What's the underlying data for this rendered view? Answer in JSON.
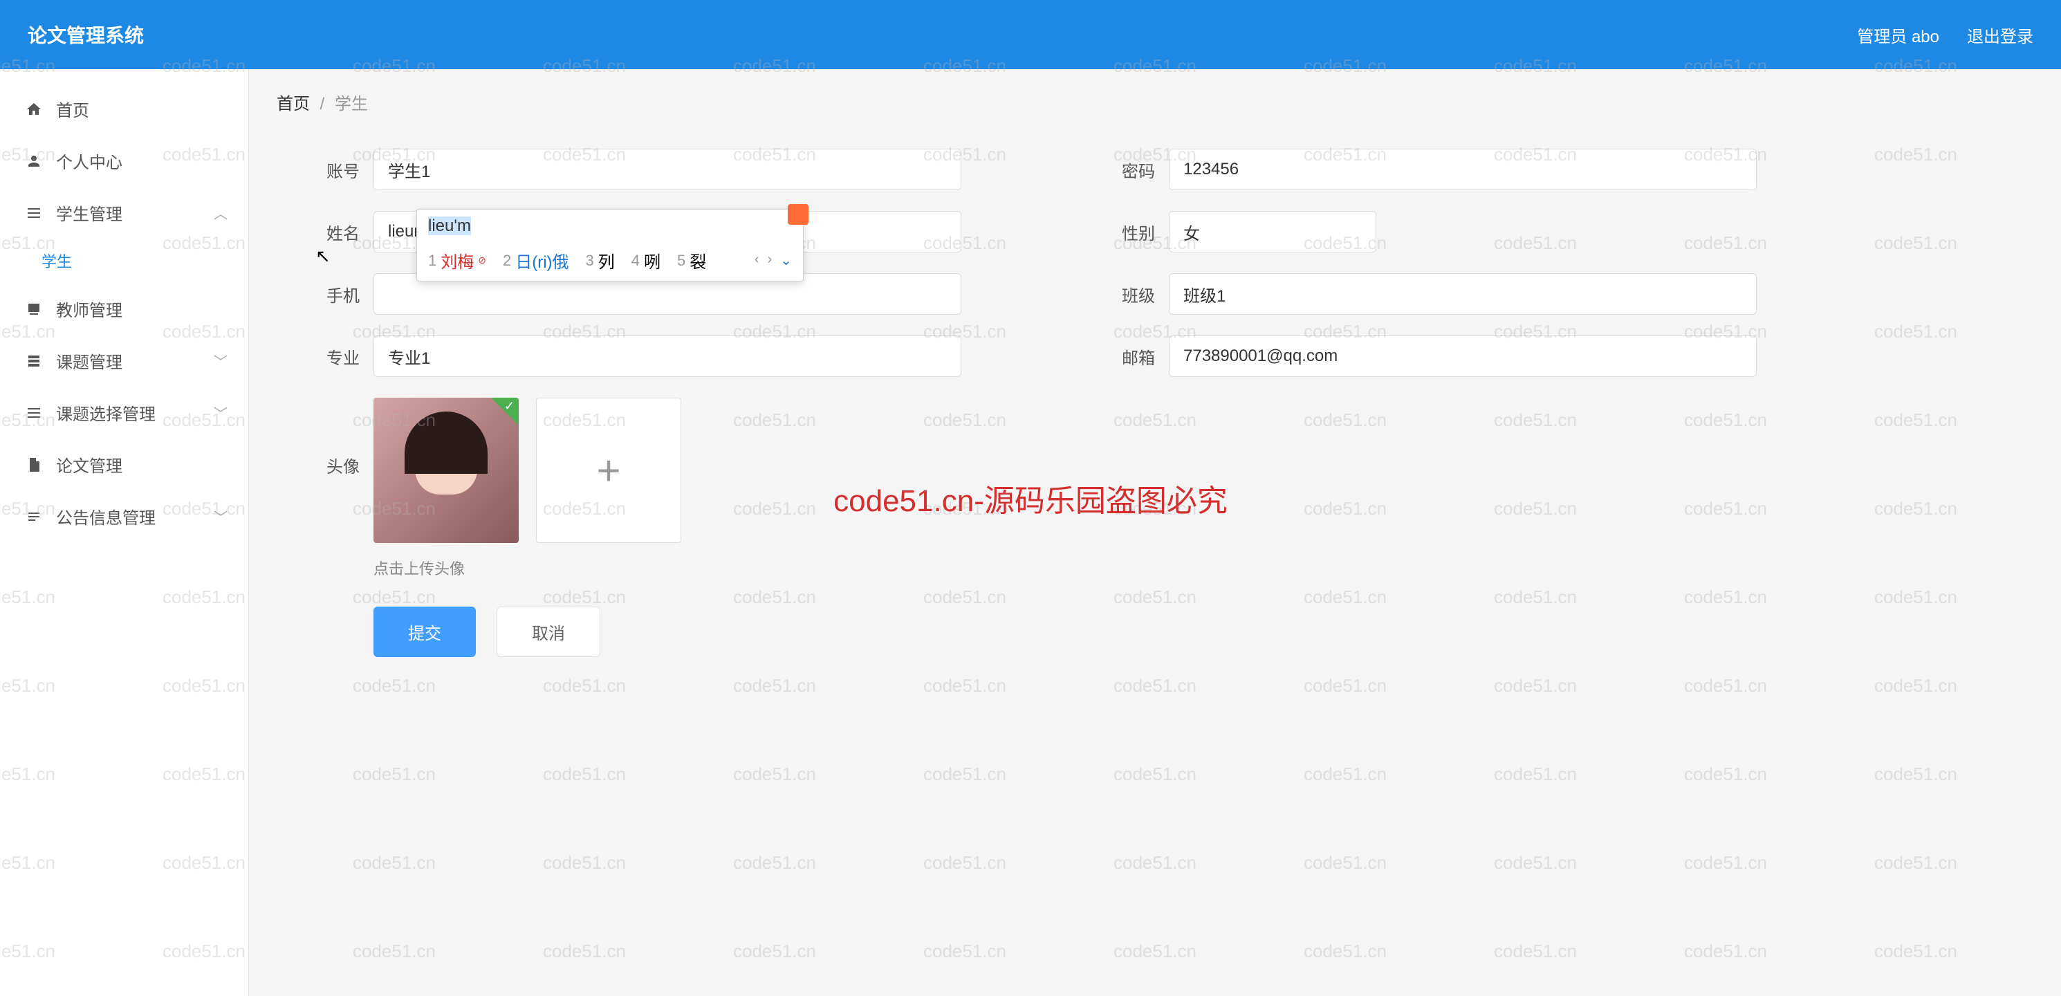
{
  "header": {
    "title": "论文管理系统",
    "admin": "管理员 abo",
    "logout": "退出登录"
  },
  "sidebar": {
    "home": "首页",
    "personal": "个人中心",
    "student_mgmt": "学生管理",
    "student": "学生",
    "teacher_mgmt": "教师管理",
    "topic_mgmt": "课题管理",
    "topic_select_mgmt": "课题选择管理",
    "thesis_mgmt": "论文管理",
    "notice_mgmt": "公告信息管理"
  },
  "breadcrumb": {
    "home": "首页",
    "current": "学生"
  },
  "form": {
    "labels": {
      "account": "账号",
      "password": "密码",
      "name": "姓名",
      "gender": "性别",
      "phone": "手机",
      "class": "班级",
      "major": "专业",
      "email": "邮箱",
      "avatar": "头像"
    },
    "values": {
      "account": "学生1",
      "password": "123456",
      "name": "lieum",
      "gender": "女",
      "phone": "",
      "class": "班级1",
      "major": "专业1",
      "email": "773890001@qq.com"
    },
    "avatar_hint": "点击上传头像",
    "submit": "提交",
    "cancel": "取消"
  },
  "ime": {
    "input": "lieu'm",
    "candidates": [
      {
        "idx": "1",
        "text": "刘梅"
      },
      {
        "idx": "2",
        "text": "日(ri)俄"
      },
      {
        "idx": "3",
        "text": "列"
      },
      {
        "idx": "4",
        "text": "咧"
      },
      {
        "idx": "5",
        "text": "裂"
      }
    ]
  },
  "watermark": {
    "text": "code51.cn",
    "center": "code51.cn-源码乐园盗图必究"
  }
}
